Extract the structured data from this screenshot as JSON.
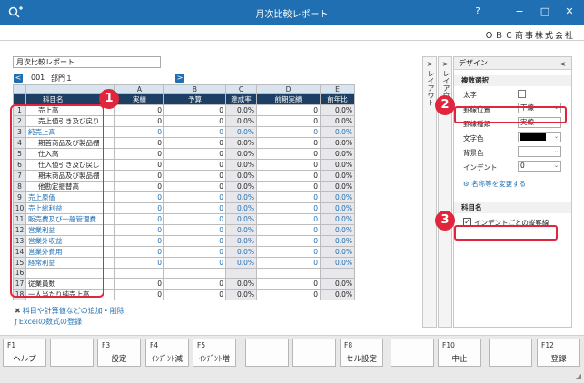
{
  "window": {
    "title": "月次比較レポート",
    "company": "ＯＢＣ商事株式会社",
    "minimize": "−",
    "maximize": "□",
    "close": "✕",
    "menu": "?"
  },
  "report_name": "月次比較レポート",
  "dept": {
    "code": "001",
    "name": "部門１",
    "prev": "<",
    "next": ">"
  },
  "grid": {
    "col_letters": [
      "A",
      "B",
      "C",
      "D",
      "E"
    ],
    "headers": {
      "name": "科目名",
      "a": "実績",
      "b": "予算",
      "c": "達成率",
      "d": "前期実績",
      "e": "前年比"
    },
    "rows": [
      {
        "no": "1",
        "name": "売上高",
        "a": "0",
        "b": "0",
        "c": "0.0%",
        "d": "0",
        "e": "0.0%"
      },
      {
        "no": "2",
        "name": "売上値引き及び戻り",
        "a": "0",
        "b": "0",
        "c": "0.0%",
        "d": "0",
        "e": "0.0%"
      },
      {
        "no": "3",
        "name": "純売上高",
        "a": "0",
        "b": "0",
        "c": "0.0%",
        "d": "0",
        "e": "0.0%"
      },
      {
        "no": "4",
        "name": "期首商品及び製品棚",
        "a": "0",
        "b": "0",
        "c": "0.0%",
        "d": "0",
        "e": "0.0%"
      },
      {
        "no": "5",
        "name": "仕入高",
        "a": "0",
        "b": "0",
        "c": "0.0%",
        "d": "0",
        "e": "0.0%"
      },
      {
        "no": "6",
        "name": "仕入値引き及び戻し",
        "a": "0",
        "b": "0",
        "c": "0.0%",
        "d": "0",
        "e": "0.0%"
      },
      {
        "no": "7",
        "name": "期末商品及び製品棚",
        "a": "0",
        "b": "0",
        "c": "0.0%",
        "d": "0",
        "e": "0.0%"
      },
      {
        "no": "8",
        "name": "他勘定振替高",
        "a": "0",
        "b": "0",
        "c": "0.0%",
        "d": "0",
        "e": "0.0%"
      },
      {
        "no": "9",
        "name": "売上原価",
        "a": "0",
        "b": "0",
        "c": "0.0%",
        "d": "0",
        "e": "0.0%"
      },
      {
        "no": "10",
        "name": "売上総利益",
        "a": "0",
        "b": "0",
        "c": "0.0%",
        "d": "0",
        "e": "0.0%"
      },
      {
        "no": "11",
        "name": "販売費及び一般管理費",
        "a": "0",
        "b": "0",
        "c": "0.0%",
        "d": "0",
        "e": "0.0%"
      },
      {
        "no": "12",
        "name": "営業利益",
        "a": "0",
        "b": "0",
        "c": "0.0%",
        "d": "0",
        "e": "0.0%"
      },
      {
        "no": "13",
        "name": "営業外収益",
        "a": "0",
        "b": "0",
        "c": "0.0%",
        "d": "0",
        "e": "0.0%"
      },
      {
        "no": "14",
        "name": "営業外費用",
        "a": "0",
        "b": "0",
        "c": "0.0%",
        "d": "0",
        "e": "0.0%"
      },
      {
        "no": "15",
        "name": "経常利益",
        "a": "0",
        "b": "0",
        "c": "0.0%",
        "d": "0",
        "e": "0.0%"
      },
      {
        "no": "16",
        "name": "",
        "a": "",
        "b": "",
        "c": "",
        "d": "",
        "e": ""
      },
      {
        "no": "17",
        "name": "従業員数",
        "a": "0",
        "b": "0",
        "c": "0.0%",
        "d": "0",
        "e": "0.0%"
      },
      {
        "no": "18",
        "name": "一人当たり純売上高",
        "a": "0",
        "b": "0",
        "c": "0.0%",
        "d": "0",
        "e": "0.0%"
      }
    ]
  },
  "links": {
    "add_remove": "科目や計算値などの追加・削除",
    "excel": "Excelの数式の登録"
  },
  "side_tabs": {
    "left": "レイアウト",
    "right": "レイアウト"
  },
  "design": {
    "title": "デザイン",
    "collapse": "<",
    "section_multi": "複数選択",
    "bold_label": "太字",
    "border_pos_label": "罫線位置",
    "border_pos_value": "下線",
    "border_type_label": "罫線種類",
    "border_type_value": "実線",
    "text_color_label": "文字色",
    "bg_color_label": "背景色",
    "indent_label": "インデント",
    "indent_value": "0",
    "change_name_link": "名称等を変更する",
    "section_item": "科目名",
    "indent_border_label": "インデントごとの縦罫線",
    "indent_border_check": "✓"
  },
  "badges": [
    "1",
    "2",
    "3"
  ],
  "fkeys": [
    {
      "key": "F1",
      "label": "ヘルプ"
    },
    {
      "key": "",
      "label": ""
    },
    {
      "key": "F3",
      "label": "設定"
    },
    {
      "key": "F4",
      "label": "ｲﾝﾃﾞﾝﾄ減"
    },
    {
      "key": "F5",
      "label": "ｲﾝﾃﾞﾝﾄ増"
    },
    {
      "key": "",
      "label": ""
    },
    {
      "key": "",
      "label": ""
    },
    {
      "key": "F8",
      "label": "セル設定"
    },
    {
      "key": "",
      "label": ""
    },
    {
      "key": "F10",
      "label": "中止"
    },
    {
      "key": "",
      "label": ""
    },
    {
      "key": "F12",
      "label": "登録"
    }
  ],
  "colors": {
    "accent": "#1f6fb2",
    "header_dark": "#1d3f63",
    "callout": "#e0263c"
  }
}
